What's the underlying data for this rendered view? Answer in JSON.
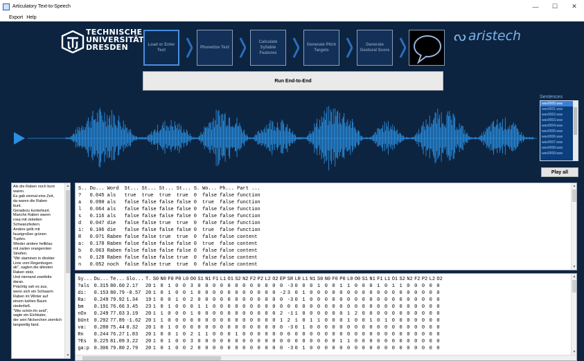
{
  "window": {
    "title": "Articulatory Text-to-Speech",
    "minimize": "—",
    "maximize": "☐",
    "close": "✕"
  },
  "menu": [
    "Export",
    "Help"
  ],
  "header": {
    "tud_line1": "TECHNISCHE",
    "tud_line2": "UNIVERSITÄT",
    "tud_line3": "DRESDEN",
    "brand": "aristech",
    "pipeline": [
      {
        "label": "Load or Enter Text",
        "active": true
      },
      {
        "label": "Phonetize Text",
        "active": false
      },
      {
        "label": "Calculate Syllable Features",
        "active": false
      },
      {
        "label": "Generate Pitch Targets",
        "active": false
      },
      {
        "label": "Generate Gestural Score",
        "active": false
      }
    ],
    "run_label": "Run End-to-End"
  },
  "sentences": {
    "title": "Sentences",
    "items": [
      "wav0000.wav",
      "wav0001.wav",
      "wav0002.wav",
      "wav0003.wav",
      "wav0004.wav",
      "wav0005.wav",
      "wav0006.wav",
      "wav0007.wav",
      "wav0008.wav",
      "wav0009.wav"
    ],
    "selected": 0,
    "play_all": "Play all"
  },
  "text_lines": [
    "Als die Raben noch bunt",
    "waren.",
    "Es gab einmal eine Zeit,",
    "da waren die Raben",
    "bunt.",
    "Geradezu kunterbunt.",
    "Manche Raben waren",
    "rosa mit violetten",
    "Schwanzfedern.",
    "Andere gelb mit",
    "faustgroßen grünen",
    "Tupfen.",
    "Wieder andere hellblau",
    "mit zarten orangeroten",
    "Streifen.",
    "\"Wir stammen in direkter",
    "Linie vom Regenbogen",
    "ab\", sagten die ältesten",
    "Raben stolz.",
    "Und niemand zweifelte",
    "daran.",
    "Prächtig sah es aus,",
    "wenn sich ein Schwarm",
    "Raben im Winter auf",
    "einem kahlen Baum",
    "niederließ.",
    "\"Wie schön ihr seid\",",
    "sagte ein Eichkater,",
    "der sein Nickerchen ziemlich",
    "langweilig fand."
  ],
  "words_table": {
    "headers": [
      "S..",
      "Du...",
      "Word",
      "St...",
      "St...",
      "St...",
      "St...",
      "S.",
      "Wo...",
      "Ph...",
      "Part ..."
    ],
    "rows": [
      [
        "?",
        "0.045",
        "als",
        "true",
        "true",
        "true",
        "true",
        "0",
        "false",
        "false",
        "function"
      ],
      [
        "a",
        "0.090",
        "als",
        "false",
        "false",
        "false",
        "false",
        "0",
        "true",
        "false",
        "function"
      ],
      [
        "l",
        "0.064",
        "als",
        "false",
        "false",
        "false",
        "false",
        "0",
        "false",
        "false",
        "function"
      ],
      [
        "s",
        "0.116",
        "als",
        "false",
        "false",
        "false",
        "false",
        "0",
        "false",
        "false",
        "function"
      ],
      [
        "d",
        "0.047",
        "die",
        "false",
        "false",
        "true",
        "true",
        "0",
        "false",
        "false",
        "function"
      ],
      [
        "i:",
        "0.106",
        "die",
        "false",
        "false",
        "false",
        "false",
        "0",
        "true",
        "false",
        "function"
      ],
      [
        "R",
        "0.071",
        "Raben",
        "false",
        "false",
        "true",
        "true",
        "0",
        "false",
        "false",
        "content"
      ],
      [
        "a:",
        "0.178",
        "Raben",
        "false",
        "false",
        "false",
        "false",
        "0",
        "true",
        "false",
        "content"
      ],
      [
        "b",
        "0.063",
        "Raben",
        "false",
        "false",
        "false",
        "false",
        "0",
        "false",
        "false",
        "content"
      ],
      [
        "n",
        "0.128",
        "Raben",
        "false",
        "false",
        "false",
        "true",
        "0",
        "false",
        "false",
        "content"
      ],
      [
        "n",
        "0.052",
        "noch",
        "false",
        "false",
        "true",
        "true",
        "0",
        "false",
        "false",
        "content"
      ]
    ]
  },
  "phones_table": {
    "headers": [
      "Sy...",
      "Du...",
      "Te...",
      "Slo...",
      "T.",
      "S0",
      "N0",
      "F0",
      "P0",
      "L0",
      "O0",
      "S1",
      "N1",
      "F1",
      "L1",
      "O1",
      "S2",
      "N2",
      "F2",
      "P2",
      "L2",
      "O2",
      "EP",
      "SR",
      "LR",
      "L1",
      "N1",
      "S0",
      "N0",
      "F0",
      "P0",
      "L0",
      "O0",
      "S1",
      "N1",
      "F1",
      "L1",
      "O1",
      "S2",
      "N2",
      "F2",
      "P2",
      "L2",
      "O2"
    ],
    "rows": [
      [
        "?als",
        "0.315",
        "80.60",
        "2.17",
        "20",
        "1",
        "0",
        "1",
        "0",
        "0",
        "3",
        "0",
        "0",
        "0",
        "0",
        "0",
        "0",
        "0",
        "0",
        "0",
        "0",
        "0",
        "0",
        "-3",
        "0",
        "0",
        "0",
        "1",
        "0",
        "0",
        "1",
        "1",
        "0",
        "0",
        "0",
        "1",
        "0",
        "1",
        "1",
        "0",
        "0",
        "0",
        "0",
        "0"
      ],
      [
        "di:",
        "0.153",
        "80.79",
        "-0.57",
        "20",
        "1",
        "0",
        "1",
        "0",
        "0",
        "1",
        "0",
        "0",
        "0",
        "0",
        "0",
        "0",
        "0",
        "0",
        "0",
        "0",
        "0",
        "-2",
        "3",
        "0",
        "1",
        "0",
        "0",
        "0",
        "0",
        "0",
        "0",
        "0",
        "0",
        "0",
        "0",
        "0",
        "0",
        "0",
        "0",
        "0",
        "0",
        "0",
        "0"
      ],
      [
        "Ra:",
        "0.249",
        "79.92",
        "1.34",
        "19",
        "1",
        "0",
        "0",
        "1",
        "0",
        "2",
        "0",
        "0",
        "0",
        "0",
        "0",
        "0",
        "0",
        "0",
        "0",
        "0",
        "0",
        "0",
        "-3",
        "0",
        "1",
        "0",
        "0",
        "0",
        "0",
        "0",
        "0",
        "0",
        "0",
        "0",
        "0",
        "0",
        "0",
        "0",
        "0",
        "0",
        "0",
        "0",
        "0"
      ],
      [
        "bm",
        "0.191",
        "76.66",
        "3.45",
        "23",
        "1",
        "0",
        "1",
        "0",
        "0",
        "0",
        "1",
        "1",
        "0",
        "0",
        "0",
        "0",
        "0",
        "0",
        "0",
        "0",
        "0",
        "0",
        "0",
        "0",
        "0",
        "0",
        "0",
        "0",
        "0",
        "0",
        "0",
        "0",
        "0",
        "0",
        "0",
        "0",
        "0",
        "0",
        "0",
        "0",
        "0",
        "0",
        "0"
      ],
      [
        "nOx",
        "0.249",
        "77.03",
        "3.19",
        "20",
        "1",
        "1",
        "0",
        "0",
        "0",
        "1",
        "0",
        "0",
        "0",
        "0",
        "0",
        "0",
        "0",
        "0",
        "0",
        "0",
        "0",
        "2",
        "-1",
        "1",
        "0",
        "0",
        "0",
        "0",
        "0",
        "0",
        "1",
        "2",
        "0",
        "0",
        "0",
        "0",
        "0",
        "0",
        "0",
        "0",
        "0",
        "0",
        "0"
      ],
      [
        "bUnt",
        "0.292",
        "77.89",
        "-1.62",
        "20",
        "1",
        "1",
        "0",
        "0",
        "0",
        "0",
        "0",
        "0",
        "0",
        "0",
        "0",
        "0",
        "0",
        "0",
        "0",
        "0",
        "0",
        "1",
        "2",
        "1",
        "0",
        "1",
        "1",
        "0",
        "0",
        "0",
        "1",
        "0",
        "0",
        "1",
        "0",
        "1",
        "0",
        "0",
        "0",
        "0",
        "0",
        "0",
        "0"
      ],
      [
        "va:",
        "0.280",
        "75.44",
        "0.32",
        "20",
        "1",
        "0",
        "1",
        "0",
        "0",
        "0",
        "0",
        "0",
        "0",
        "0",
        "0",
        "0",
        "0",
        "0",
        "0",
        "0",
        "0",
        "0",
        "-3",
        "0",
        "1",
        "0",
        "0",
        "0",
        "0",
        "0",
        "0",
        "0",
        "0",
        "0",
        "0",
        "0",
        "0",
        "0",
        "0",
        "0",
        "0",
        "0",
        "0"
      ],
      [
        "Rn",
        "0.244",
        "76.27",
        "1.83",
        "20",
        "1",
        "0",
        "0",
        "1",
        "0",
        "2",
        "1",
        "1",
        "0",
        "0",
        "0",
        "1",
        "0",
        "0",
        "0",
        "0",
        "0",
        "0",
        "0",
        "0",
        "0",
        "0",
        "0",
        "0",
        "0",
        "0",
        "0",
        "0",
        "0",
        "0",
        "0",
        "0",
        "0",
        "0",
        "0",
        "0",
        "0",
        "0",
        "0"
      ],
      [
        "?Es",
        "0.225",
        "81.09",
        "3.22",
        "20",
        "1",
        "0",
        "1",
        "0",
        "0",
        "3",
        "0",
        "0",
        "0",
        "0",
        "0",
        "0",
        "0",
        "0",
        "0",
        "0",
        "0",
        "0",
        "0",
        "0",
        "0",
        "0",
        "0",
        "0",
        "0",
        "1",
        "1",
        "0",
        "0",
        "0",
        "0",
        "0",
        "0",
        "0",
        "0",
        "0",
        "0",
        "0",
        "0"
      ],
      [
        "ga:p",
        "0.306",
        "79.80",
        "2.79",
        "20",
        "1",
        "0",
        "1",
        "0",
        "0",
        "2",
        "0",
        "0",
        "0",
        "0",
        "0",
        "0",
        "0",
        "0",
        "0",
        "0",
        "0",
        "0",
        "-3",
        "0",
        "1",
        "0",
        "0",
        "0",
        "0",
        "0",
        "0",
        "0",
        "0",
        "0",
        "0",
        "0",
        "0",
        "0",
        "0",
        "0",
        "0",
        "0",
        "0"
      ]
    ]
  },
  "colors": {
    "background": "#0d2440",
    "waveform": "#2a8fe0",
    "accent": "#7fb2ea"
  },
  "icons": {
    "play": "play-icon",
    "speech": "speech-bubble-icon"
  }
}
